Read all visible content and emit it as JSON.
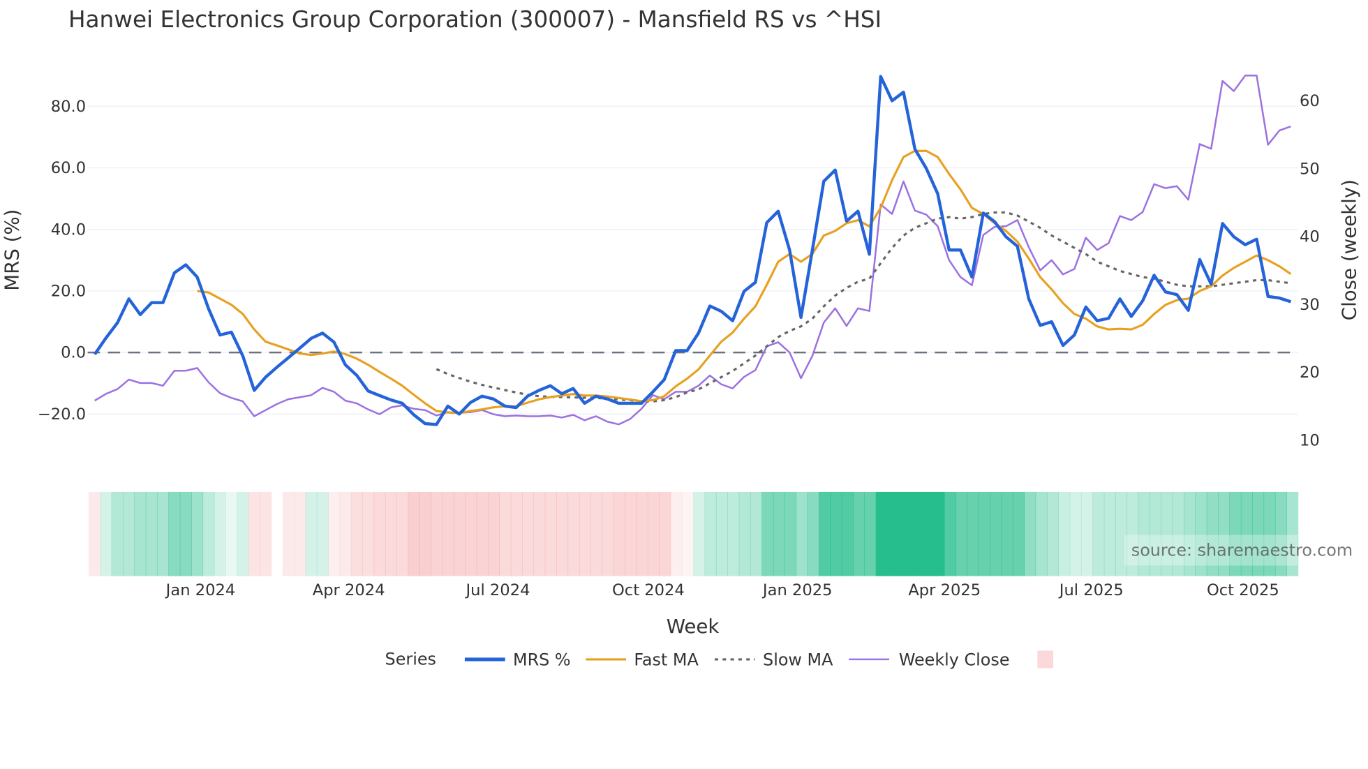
{
  "chart_data": {
    "type": "line",
    "title": "Hanwei Electronics Group Corporation (300007) - Mansfield RS vs ^HSI",
    "xlabel": "Week",
    "ylabel": "MRS (%)",
    "y2label": "Close (weekly)",
    "ylim": [
      -37,
      93
    ],
    "y2lim": [
      6,
      64.5
    ],
    "yticks": [
      -20,
      0,
      20,
      40,
      60,
      80
    ],
    "ytick_labels": [
      "−20.0",
      "0.0",
      "20.0",
      "40.0",
      "60.0",
      "80.0"
    ],
    "y2ticks": [
      10,
      20,
      30,
      40,
      50,
      60
    ],
    "y2tick_labels": [
      "10",
      "20",
      "30",
      "40",
      "50",
      "60"
    ],
    "xticks": [
      9.3,
      22.3,
      35.4,
      48.6,
      61.7,
      74.6,
      87.5,
      100.8
    ],
    "xtick_labels": [
      "Jan 2024",
      "Apr 2024",
      "Jul 2024",
      "Oct 2024",
      "Jan 2025",
      "Apr 2025",
      "Jul 2025",
      "Oct 2025"
    ],
    "x_range_weeks": [
      0,
      105
    ],
    "zero_line": 0,
    "grid": true,
    "legend": {
      "title": "Series",
      "placement": "bottom-center"
    },
    "watermark": "source: sharemaestro.com",
    "series": [
      {
        "name": "MRS %",
        "axis": "left",
        "color": "#2563d9",
        "style": "solid",
        "start": 0,
        "values": [
          -0.6,
          4.8,
          9.7,
          17.4,
          12.3,
          16.2,
          16.2,
          25.9,
          28.5,
          24.5,
          14.2,
          5.7,
          6.6,
          -1.1,
          -12.3,
          -8.0,
          -4.8,
          -1.7,
          1.4,
          4.6,
          6.3,
          3.4,
          -4.0,
          -7.4,
          -12.5,
          -14.0,
          -15.4,
          -16.5,
          -20.2,
          -23.1,
          -23.4,
          -17.4,
          -20.0,
          -16.2,
          -14.2,
          -15.1,
          -17.4,
          -17.9,
          -14.2,
          -12.3,
          -10.8,
          -13.4,
          -11.7,
          -16.5,
          -14.2,
          -15.1,
          -16.5,
          -16.5,
          -16.5,
          -12.8,
          -8.8,
          0.6,
          0.6,
          6.3,
          15.1,
          13.4,
          10.3,
          19.9,
          22.8,
          42.2,
          45.9,
          33.3,
          11.4,
          33.3,
          55.6,
          59.3,
          42.7,
          45.9,
          31.9,
          89.7,
          81.8,
          84.6,
          66.1,
          59.8,
          51.6,
          33.3,
          33.3,
          24.5,
          45.3,
          42.5,
          37.6,
          34.5,
          17.4,
          8.8,
          10.0,
          2.3,
          5.7,
          14.8,
          10.3,
          11.1,
          17.4,
          11.7,
          16.8,
          25.1,
          19.7,
          18.8,
          13.7,
          30.2,
          22.2,
          41.9,
          37.6,
          35.0,
          36.8,
          18.2,
          17.7,
          16.5
        ]
      },
      {
        "name": "Fast MA",
        "axis": "left",
        "color": "#e8a020",
        "style": "solid",
        "start": 9,
        "values": [
          20.0,
          19.5,
          17.5,
          15.5,
          12.5,
          7.5,
          3.5,
          2.3,
          1.0,
          -0.3,
          -0.8,
          -0.3,
          0.3,
          -0.5,
          -2.0,
          -4.0,
          -6.3,
          -8.5,
          -10.8,
          -13.7,
          -16.5,
          -19.0,
          -19.5,
          -19.7,
          -19.0,
          -18.5,
          -17.8,
          -17.5,
          -17.5,
          -16.3,
          -15.2,
          -14.5,
          -14.0,
          -13.5,
          -14.0,
          -14.0,
          -14.3,
          -14.8,
          -15.3,
          -15.8,
          -15.5,
          -14.2,
          -11.0,
          -8.5,
          -5.5,
          -1.0,
          3.5,
          6.5,
          11.0,
          15.0,
          22.0,
          29.5,
          32.0,
          29.5,
          32.0,
          38.0,
          39.5,
          42.0,
          43.0,
          41.0,
          47.0,
          56.0,
          63.5,
          65.5,
          65.5,
          63.5,
          58.0,
          53.0,
          47.0,
          45.0,
          42.0,
          39.5,
          36.0,
          30.5,
          24.5,
          20.5,
          16.0,
          12.5,
          11.0,
          8.5,
          7.5,
          7.7,
          7.5,
          9.0,
          12.5,
          15.5,
          17.0,
          17.5,
          20.0,
          21.5,
          25.0,
          27.5,
          29.5,
          31.5,
          30.0,
          28.0,
          25.5
        ]
      },
      {
        "name": "Slow MA",
        "axis": "left",
        "color": "#666666",
        "style": "dotted",
        "start": 30,
        "values": [
          -5.4,
          -7,
          -8.3,
          -9.5,
          -10.5,
          -11.4,
          -12.2,
          -13,
          -13.7,
          -14.2,
          -14.4,
          -14.5,
          -14.6,
          -14.7,
          -14.8,
          -15,
          -15.3,
          -15.5,
          -15.8,
          -15.9,
          -15.5,
          -14.5,
          -13,
          -12,
          -10,
          -8,
          -6,
          -3.5,
          -1,
          2,
          5,
          7,
          8.5,
          11,
          15,
          18.5,
          21,
          23,
          24,
          29,
          34,
          38,
          40.5,
          42,
          43.5,
          44,
          43.5,
          44,
          45,
          45.5,
          45.5,
          44.5,
          42.5,
          40.5,
          38,
          36,
          34,
          32,
          29.5,
          28,
          26.5,
          25.5,
          24.5,
          24,
          23,
          22,
          21.5,
          21.5,
          21.5,
          22,
          22.5,
          23,
          23.5,
          23.5,
          23,
          22.5
        ]
      },
      {
        "name": "Weekly Close",
        "axis": "right",
        "color": "#9b72e0",
        "style": "solid",
        "start": 0,
        "values": [
          15.7,
          16.7,
          17.4,
          18.8,
          18.3,
          18.3,
          17.9,
          20.1,
          20.1,
          20.5,
          18.4,
          16.8,
          16.1,
          15.6,
          13.4,
          14.3,
          15.2,
          15.9,
          16.2,
          16.5,
          17.6,
          17.0,
          15.7,
          15.3,
          14.4,
          13.7,
          14.7,
          15.0,
          14.5,
          14.3,
          13.5,
          14.0,
          13.9,
          14.0,
          14.3,
          13.7,
          13.4,
          13.5,
          13.4,
          13.4,
          13.5,
          13.2,
          13.6,
          12.8,
          13.4,
          12.6,
          12.2,
          13.0,
          14.5,
          16.5,
          15.9,
          17.0,
          17.0,
          17.9,
          19.4,
          18.1,
          17.5,
          19.2,
          20.2,
          23.7,
          24.3,
          22.8,
          19.0,
          22.3,
          27.2,
          29.3,
          26.7,
          29.3,
          28.9,
          44.6,
          43.2,
          48.0,
          43.7,
          43.1,
          41.4,
          36.4,
          33.9,
          32.7,
          40.1,
          41.3,
          41.4,
          42.3,
          38.3,
          34.9,
          36.4,
          34.3,
          35.1,
          39.7,
          37.9,
          38.9,
          42.9,
          42.3,
          43.5,
          47.6,
          47.0,
          47.3,
          45.3,
          53.5,
          52.8,
          62.8,
          61.3,
          63.6,
          63.6,
          53.4,
          55.5,
          56.1
        ]
      }
    ],
    "heatmap": {
      "name": "",
      "legend_color": "#fbd9da",
      "positive_color": "#26be8c",
      "negative_color": "#f29496",
      "values": [
        -0.2,
        0.2,
        0.35,
        0.35,
        0.4,
        0.4,
        0.4,
        0.55,
        0.55,
        0.45,
        0.3,
        0.2,
        0.1,
        0.2,
        -0.25,
        -0.25,
        null,
        -0.2,
        -0.2,
        0.2,
        0.2,
        -0.15,
        -0.2,
        -0.3,
        -0.3,
        -0.35,
        -0.35,
        -0.35,
        -0.45,
        -0.45,
        -0.4,
        -0.4,
        -0.4,
        -0.4,
        -0.4,
        -0.4,
        -0.35,
        -0.35,
        -0.35,
        -0.35,
        -0.35,
        -0.35,
        -0.35,
        -0.35,
        -0.35,
        -0.35,
        -0.38,
        -0.38,
        -0.38,
        -0.38,
        -0.38,
        -0.15,
        -0.1,
        0.2,
        0.3,
        0.3,
        0.3,
        0.35,
        0.35,
        0.6,
        0.6,
        0.6,
        0.45,
        0.55,
        0.8,
        0.8,
        0.8,
        0.7,
        0.7,
        1.0,
        1.0,
        1.0,
        1.0,
        1.0,
        1.0,
        0.8,
        0.7,
        0.7,
        0.7,
        0.7,
        0.7,
        0.7,
        0.5,
        0.4,
        0.35,
        0.25,
        0.2,
        0.2,
        0.3,
        0.3,
        0.3,
        0.3,
        0.35,
        0.35,
        0.35,
        0.35,
        0.4,
        0.45,
        0.5,
        0.5,
        0.6,
        0.6,
        0.6,
        0.6,
        0.55,
        0.4
      ]
    }
  }
}
